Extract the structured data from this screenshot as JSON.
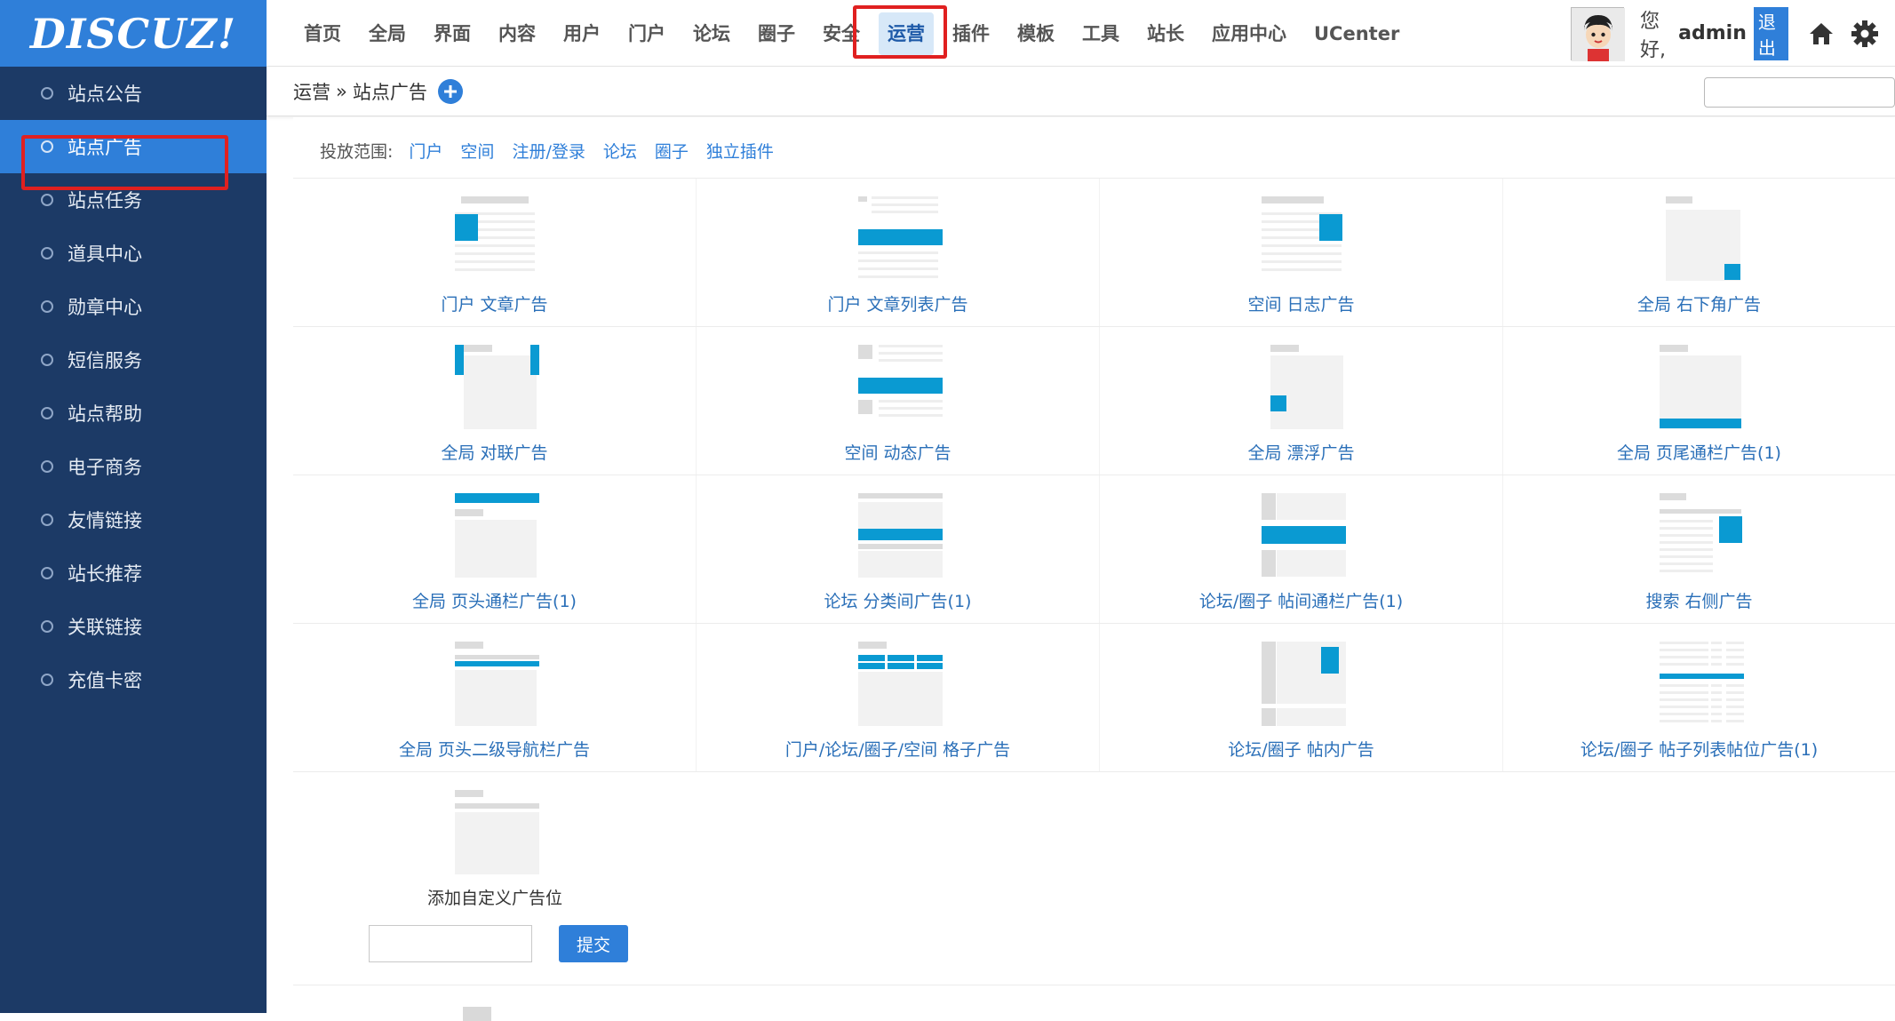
{
  "logo": {
    "text": "DISCUZ!"
  },
  "nav": {
    "items": [
      "首页",
      "全局",
      "界面",
      "内容",
      "用户",
      "门户",
      "论坛",
      "圈子",
      "安全",
      "运营",
      "插件",
      "模板",
      "工具",
      "站长",
      "应用中心",
      "UCenter"
    ],
    "active_index": 9
  },
  "user": {
    "greeting": "您好,",
    "name": "admin",
    "logout": "退出"
  },
  "sidebar": {
    "items": [
      "站点公告",
      "站点广告",
      "站点任务",
      "道具中心",
      "勋章中心",
      "短信服务",
      "站点帮助",
      "电子商务",
      "友情链接",
      "站长推荐",
      "关联链接",
      "充值卡密"
    ],
    "active_index": 1
  },
  "breadcrumb": {
    "parent": "运营",
    "separator": "»",
    "current": "站点广告"
  },
  "scope": {
    "label": "投放范围:",
    "links": [
      "门户",
      "空间",
      "注册/登录",
      "论坛",
      "圈子",
      "独立插件"
    ]
  },
  "ads": [
    {
      "label": "门户 文章广告",
      "thumb": "article"
    },
    {
      "label": "门户 文章列表广告",
      "thumb": "article-list"
    },
    {
      "label": "空间 日志广告",
      "thumb": "blog"
    },
    {
      "label": "全局 右下角广告",
      "thumb": "corner"
    },
    {
      "label": "全局 对联广告",
      "thumb": "couplet"
    },
    {
      "label": "空间 动态广告",
      "thumb": "feed"
    },
    {
      "label": "全局 漂浮广告",
      "thumb": "float"
    },
    {
      "label": "全局 页尾通栏广告(1)",
      "thumb": "footer"
    },
    {
      "label": "全局 页头通栏广告(1)",
      "thumb": "header"
    },
    {
      "label": "论坛 分类间广告(1)",
      "thumb": "category"
    },
    {
      "label": "论坛/圈子 帖间通栏广告(1)",
      "thumb": "interthread"
    },
    {
      "label": "搜索 右侧广告",
      "thumb": "search"
    },
    {
      "label": "全局 页头二级导航栏广告",
      "thumb": "subnav"
    },
    {
      "label": "门户/论坛/圈子/空间 格子广告",
      "thumb": "grid"
    },
    {
      "label": "论坛/圈子 帖内广告",
      "thumb": "inpost"
    },
    {
      "label": "论坛/圈子 帖子列表帖位广告(1)",
      "thumb": "threadlist"
    }
  ],
  "custom": {
    "label": "添加自定义广告位",
    "input_value": "",
    "submit": "提交"
  },
  "colors": {
    "brand": "#2f7fd9",
    "sidebar": "#1c3a66",
    "ad_accent": "#0a9ad2",
    "highlight": "#e02020"
  }
}
